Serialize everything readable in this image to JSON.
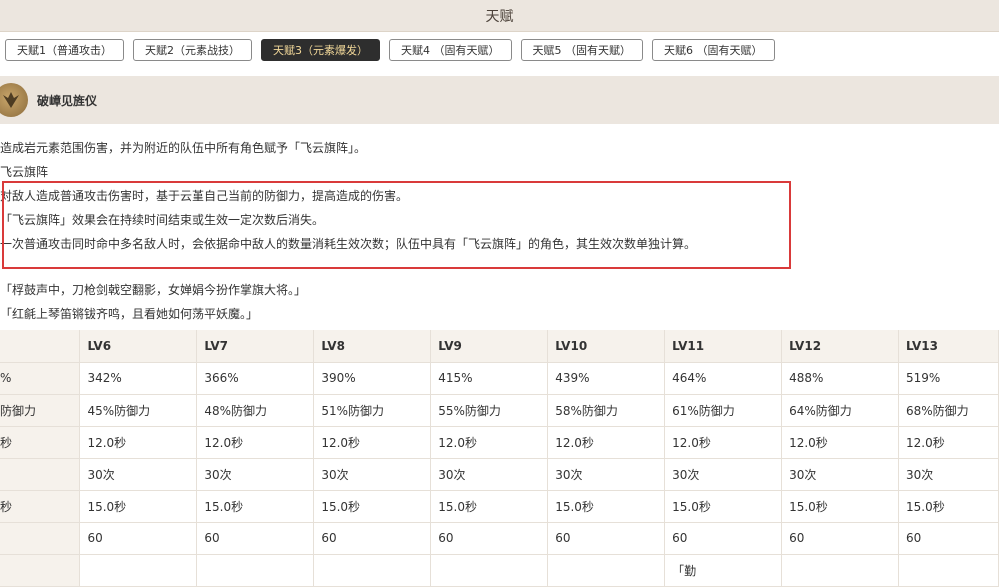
{
  "header": {
    "title": "天赋"
  },
  "tabs": [
    {
      "label": "天赋1（普通攻击）",
      "active": false
    },
    {
      "label": "天赋2（元素战技）",
      "active": false
    },
    {
      "label": "天赋3（元素爆发）",
      "active": true
    },
    {
      "label": "天赋4 （固有天赋）",
      "active": false
    },
    {
      "label": "天赋5 （固有天赋）",
      "active": false
    },
    {
      "label": "天赋6 （固有天赋）",
      "active": false
    }
  ],
  "skill": {
    "name": "破嶂见旌仪",
    "icon": "skill-icon"
  },
  "description": {
    "lines": [
      "造成岩元素范围伤害，并为附近的队伍中所有角色赋予「飞云旗阵」。",
      "飞云旗阵",
      "对敌人造成普通攻击伤害时，基于云堇自己当前的防御力，提高造成的伤害。",
      "「飞云旗阵」效果会在持续时间结束或生效一定次数后消失。",
      "一次普通攻击同时命中多名敌人时，会依据命中敌人的数量消耗生效次数；队伍中具有「飞云旗阵」的角色，其生效次数单独计算。"
    ],
    "quotes": [
      "「桴鼓声中，刀枪剑戟空翻影，女婵娟今扮作掌旗大将。」",
      "「红毹上琴笛锵钹齐鸣，且看她如何荡平妖魔。」"
    ]
  },
  "table": {
    "headers": [
      "",
      "LV6",
      "LV7",
      "LV8",
      "LV9",
      "LV10",
      "LV11",
      "LV12",
      "LV13"
    ],
    "rows": [
      [
        "%",
        "342%",
        "366%",
        "390%",
        "415%",
        "439%",
        "464%",
        "488%",
        "519%"
      ],
      [
        "防御力",
        "45%防御力",
        "48%防御力",
        "51%防御力",
        "55%防御力",
        "58%防御力",
        "61%防御力",
        "64%防御力",
        "68%防御力"
      ],
      [
        "秒",
        "12.0秒",
        "12.0秒",
        "12.0秒",
        "12.0秒",
        "12.0秒",
        "12.0秒",
        "12.0秒",
        "12.0秒"
      ],
      [
        "",
        "30次",
        "30次",
        "30次",
        "30次",
        "30次",
        "30次",
        "30次",
        "30次"
      ],
      [
        "秒",
        "15.0秒",
        "15.0秒",
        "15.0秒",
        "15.0秒",
        "15.0秒",
        "15.0秒",
        "15.0秒",
        "15.0秒"
      ],
      [
        "",
        "60",
        "60",
        "60",
        "60",
        "60",
        "60",
        "60",
        "60"
      ],
      [
        "",
        "",
        "",
        "",
        "",
        "",
        "「勤",
        "",
        ""
      ]
    ]
  }
}
